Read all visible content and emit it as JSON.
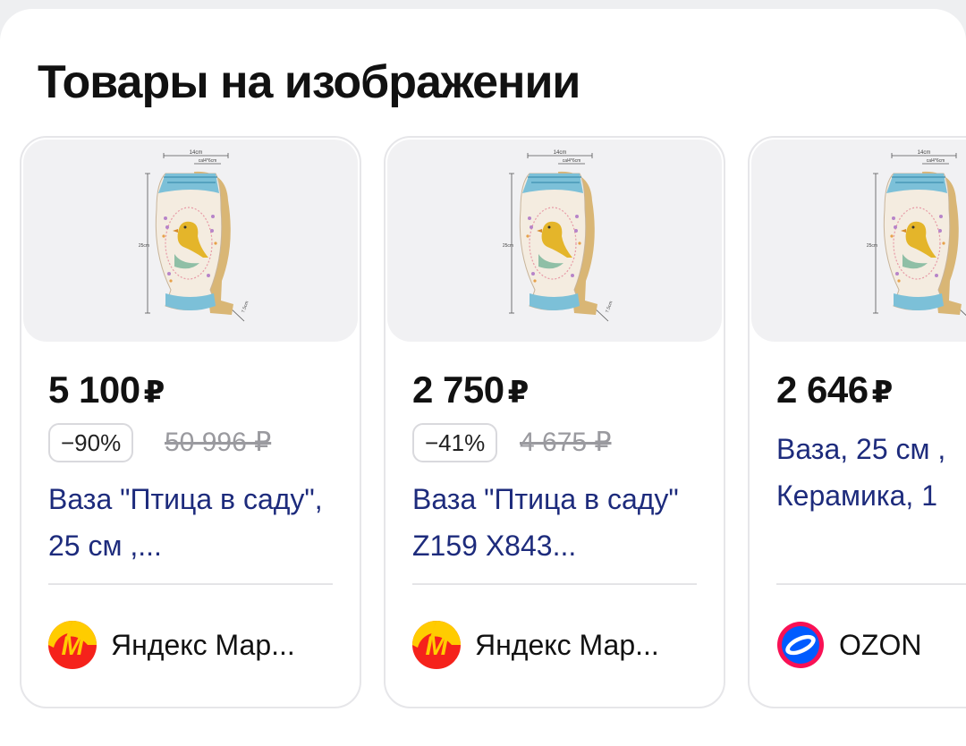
{
  "title": "Товары на изображении",
  "products": [
    {
      "price": "5 100",
      "currency": "₽",
      "discount": "−90%",
      "old_price": "50 996 ₽",
      "name": "Ваза \"Птица в саду\", 25 см ,...",
      "seller": "Яндекс Мар...",
      "seller_logo": "yandex-market-logo"
    },
    {
      "price": "2 750",
      "currency": "₽",
      "discount": "−41%",
      "old_price": "4 675 ₽",
      "name": "Ваза \"Птица в саду\" Z159 X843...",
      "seller": "Яндекс Мар...",
      "seller_logo": "yandex-market-logo"
    },
    {
      "price": "2 646",
      "currency": "₽",
      "name": "Ваза, 25 см , Керамика, 1",
      "seller": "OZON",
      "seller_logo": "ozon-logo"
    }
  ],
  "image_labels": {
    "width": "14cm",
    "inner": "cal4*6cm",
    "height": "25cm",
    "depth": "7.5cm"
  },
  "colors": {
    "link": "#1d2b7c",
    "yandex_yellow": "#ffcc00",
    "yandex_red": "#f5221b",
    "ozon_blue": "#005bff",
    "ozon_pink": "#f91155"
  }
}
